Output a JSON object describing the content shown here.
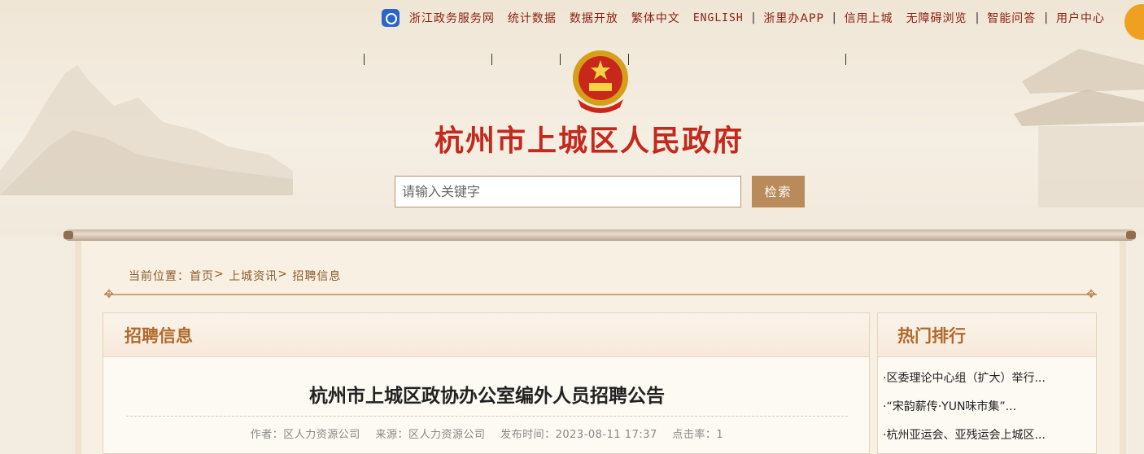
{
  "topnav": {
    "items": [
      {
        "label": "浙江政务服务网"
      },
      {
        "label": "统计数据"
      },
      {
        "label": "数据开放"
      },
      {
        "label": "繁体中文"
      },
      {
        "label": "ENGLISH"
      },
      {
        "label": "浙里办APP"
      },
      {
        "label": "信用上城"
      },
      {
        "label": "无障碍浏览"
      },
      {
        "label": "智能问答"
      },
      {
        "label": "用户中心"
      }
    ]
  },
  "site": {
    "title": "杭州市上城区人民政府"
  },
  "search": {
    "placeholder": "请输入关键字",
    "button_label": "检索"
  },
  "breadcrumb": {
    "prefix": "当前位置：",
    "items": [
      "首页",
      "上城资讯",
      "招聘信息"
    ]
  },
  "main": {
    "section_title": "招聘信息",
    "article": {
      "title": "杭州市上城区政协办公室编外人员招聘公告",
      "author": "作者：区人力资源公司",
      "source": "来源：区人力资源公司",
      "publish_time": "发布时间：2023-08-11 17:37",
      "clicks": "点击率：1"
    }
  },
  "sidebar": {
    "title": "热门排行",
    "items": [
      {
        "label": "·区委理论中心组（扩大）举行..."
      },
      {
        "label": "·“宋韵薪传·YUN味市集”..."
      },
      {
        "label": "·杭州亚运会、亚残运会上城区..."
      }
    ]
  },
  "colors": {
    "title_red": "#c3291c",
    "accent_brown": "#b98a5a",
    "panel_heading": "#b06a2c"
  }
}
